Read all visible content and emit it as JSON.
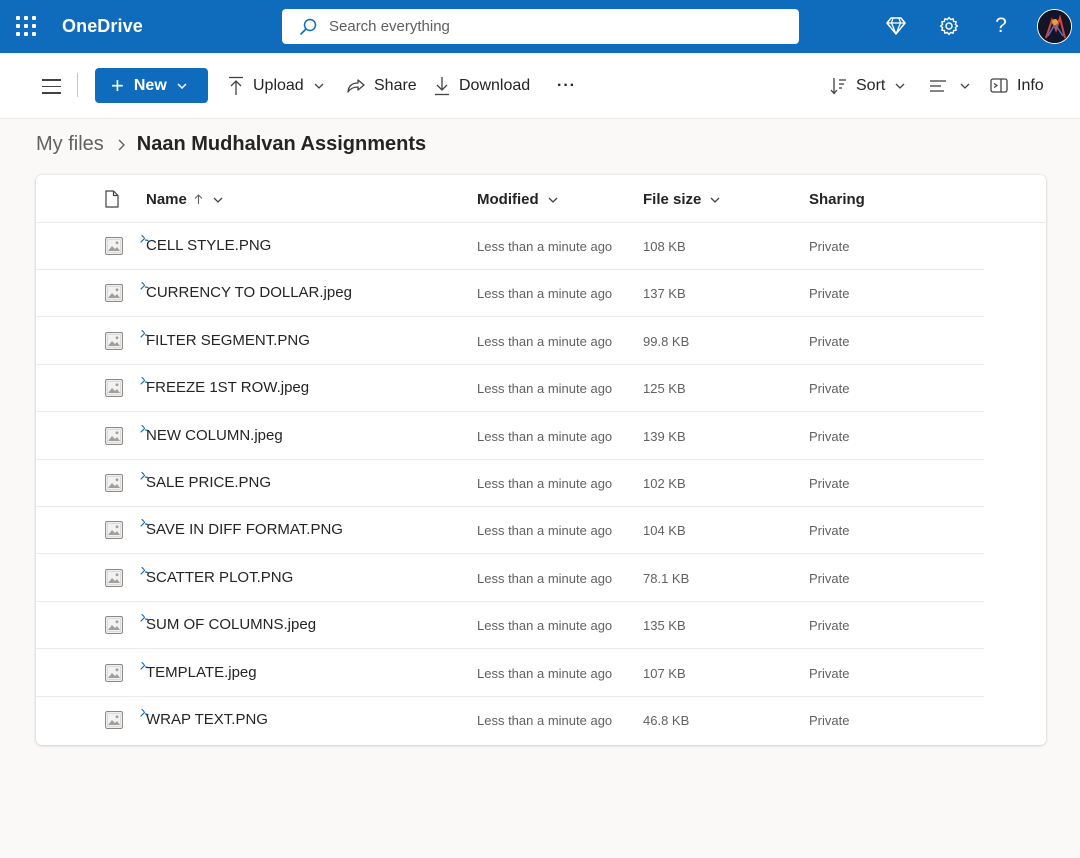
{
  "app": {
    "brand": "OneDrive"
  },
  "search": {
    "placeholder": "Search everything"
  },
  "toolbar": {
    "new_label": "New",
    "upload_label": "Upload",
    "share_label": "Share",
    "download_label": "Download",
    "more_label": "···",
    "sort_label": "Sort",
    "info_label": "Info"
  },
  "breadcrumb": {
    "parent": "My files",
    "current": "Naan Mudhalvan Assignments"
  },
  "columns": {
    "name": "Name",
    "modified": "Modified",
    "size": "File size",
    "sharing": "Sharing"
  },
  "files": [
    {
      "name": "CELL STYLE.PNG",
      "modified": "Less than a minute ago",
      "size": "108 KB",
      "sharing": "Private"
    },
    {
      "name": "CURRENCY TO DOLLAR.jpeg",
      "modified": "Less than a minute ago",
      "size": "137 KB",
      "sharing": "Private"
    },
    {
      "name": "FILTER SEGMENT.PNG",
      "modified": "Less than a minute ago",
      "size": "99.8 KB",
      "sharing": "Private"
    },
    {
      "name": "FREEZE 1ST ROW.jpeg",
      "modified": "Less than a minute ago",
      "size": "125 KB",
      "sharing": "Private"
    },
    {
      "name": "NEW COLUMN.jpeg",
      "modified": "Less than a minute ago",
      "size": "139 KB",
      "sharing": "Private"
    },
    {
      "name": "SALE PRICE.PNG",
      "modified": "Less than a minute ago",
      "size": "102 KB",
      "sharing": "Private"
    },
    {
      "name": "SAVE IN DIFF FORMAT.PNG",
      "modified": "Less than a minute ago",
      "size": "104 KB",
      "sharing": "Private"
    },
    {
      "name": "SCATTER PLOT.PNG",
      "modified": "Less than a minute ago",
      "size": "78.1 KB",
      "sharing": "Private"
    },
    {
      "name": "SUM OF COLUMNS.jpeg",
      "modified": "Less than a minute ago",
      "size": "135 KB",
      "sharing": "Private"
    },
    {
      "name": "TEMPLATE.jpeg",
      "modified": "Less than a minute ago",
      "size": "107 KB",
      "sharing": "Private"
    },
    {
      "name": "WRAP TEXT.PNG",
      "modified": "Less than a minute ago",
      "size": "46.8 KB",
      "sharing": "Private"
    }
  ],
  "icons": {
    "app_launcher": "waffle-icon",
    "search": "search-icon",
    "premium": "diamond-icon",
    "settings": "gear-icon",
    "help": "help-icon",
    "file": "image-file-icon",
    "new_file": "new-sparkle-icon"
  },
  "colors": {
    "accent": "#0f6cbd",
    "new_indicator": "#0f6cbd"
  }
}
